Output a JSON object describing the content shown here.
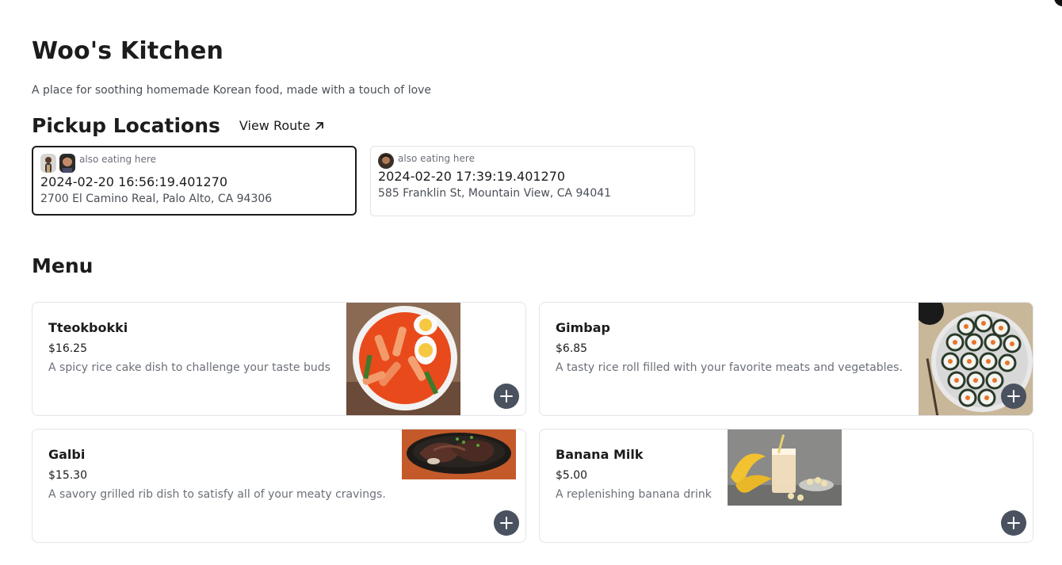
{
  "restaurant": {
    "name": "Woo's Kitchen",
    "tagline": "A place for soothing homemade Korean food, made with a touch of love"
  },
  "pickup": {
    "heading": "Pickup Locations",
    "view_route_label": "View Route",
    "locations": [
      {
        "also_label": "also eating here",
        "time": "2024-02-20 16:56:19.401270",
        "address": "2700 El Camino Real, Palo Alto, CA 94306",
        "selected": true
      },
      {
        "also_label": "also eating here",
        "time": "2024-02-20 17:39:19.401270",
        "address": "585 Franklin St, Mountain View, CA 94041",
        "selected": false
      }
    ]
  },
  "menu": {
    "heading": "Menu",
    "items": [
      {
        "name": "Tteokbokki",
        "price": "$16.25",
        "description": "A spicy rice cake dish to challenge your taste buds"
      },
      {
        "name": "Gimbap",
        "price": "$6.85",
        "description": "A tasty rice roll filled with your favorite meats and vegetables."
      },
      {
        "name": "Galbi",
        "price": "$15.30",
        "description": "A savory grilled rib dish to satisfy all of your meaty cravings."
      },
      {
        "name": "Banana Milk",
        "price": "$5.00",
        "description": "A replenishing banana drink"
      }
    ]
  },
  "colors": {
    "text_primary": "#1c1c1c",
    "text_secondary": "#6b7078",
    "border": "#e2e4e8",
    "add_button": "#4a5260"
  }
}
